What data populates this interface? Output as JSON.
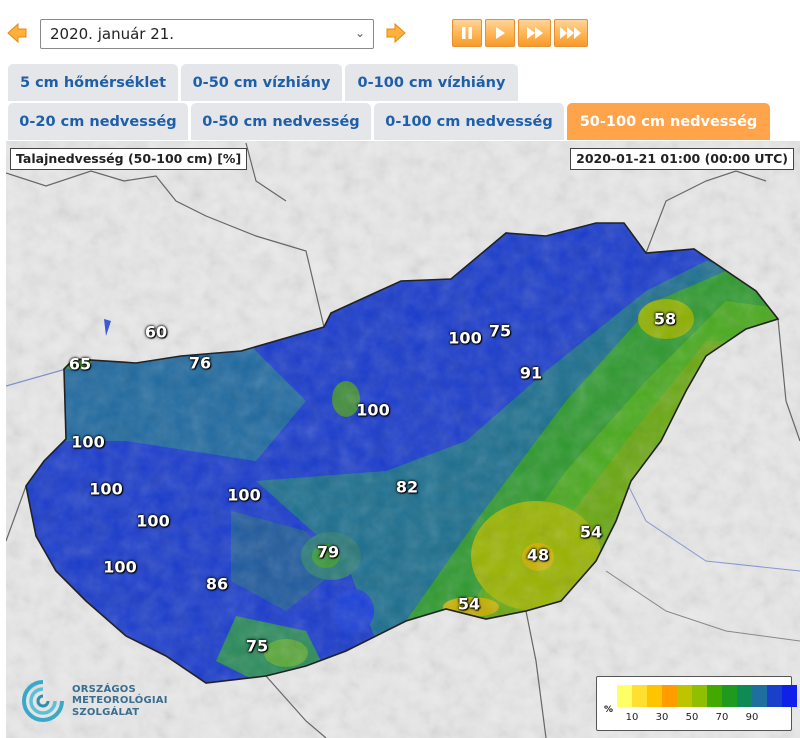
{
  "date_picker": {
    "value": "2020. január 21."
  },
  "player": {
    "buttons": [
      "pause",
      "play",
      "fast-forward",
      "fastest-forward"
    ]
  },
  "tabs_row1": [
    {
      "label": "5 cm hőmérséklet",
      "active": false
    },
    {
      "label": "0-50 cm vízhiány",
      "active": false
    },
    {
      "label": "0-100 cm vízhiány",
      "active": false
    }
  ],
  "tabs_row2": [
    {
      "label": "0-20 cm nedvesség",
      "active": false
    },
    {
      "label": "0-50 cm nedvesség",
      "active": false
    },
    {
      "label": "0-100 cm nedvesség",
      "active": false
    },
    {
      "label": "50-100 cm nedvesség",
      "active": true
    }
  ],
  "map": {
    "title": "Talajnedvesség (50-100 cm) [%]",
    "timestamp": "2020-01-21 01:00 (00:00 UTC)",
    "values": [
      "60",
      "65",
      "76",
      "100",
      "75",
      "58",
      "91",
      "100",
      "100",
      "100",
      "100",
      "82",
      "100",
      "79",
      "54",
      "48",
      "100",
      "86",
      "54",
      "75"
    ]
  },
  "logo": {
    "line1": "ORSZÁGOS",
    "line2": "METEOROLÓGIAI",
    "line3": "SZOLGÁLAT"
  },
  "legend": {
    "unit": "%",
    "ticks": [
      "10",
      "30",
      "50",
      "70",
      "90"
    ],
    "colors": [
      "#ffff66",
      "#ffe030",
      "#ffc400",
      "#ff9d00",
      "#bfc400",
      "#8fbf00",
      "#43a800",
      "#1f9a1f",
      "#0f8a55",
      "#1e6e9e",
      "#1a3fc8",
      "#1020e8"
    ]
  }
}
